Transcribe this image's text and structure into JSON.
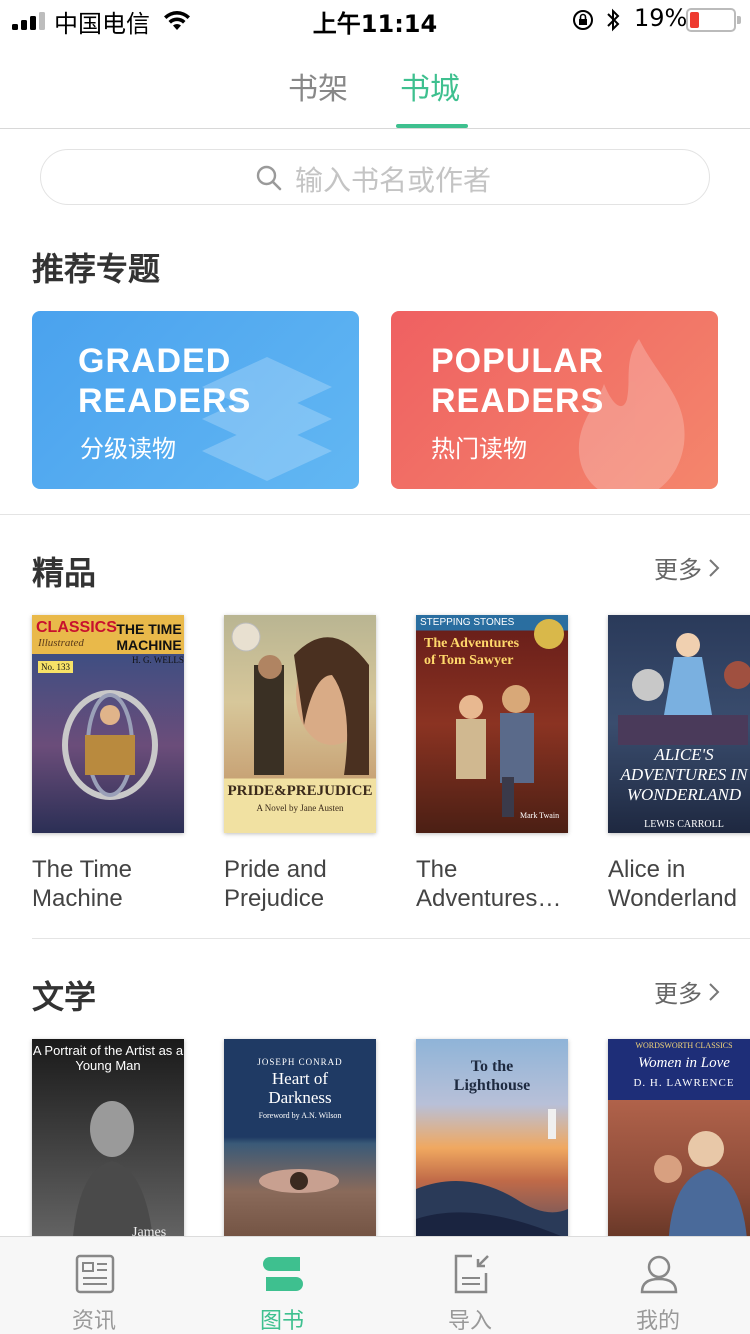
{
  "status_bar": {
    "carrier": "中国电信",
    "time": "上午11:14",
    "battery_percent": "19%",
    "battery_level": 0.19
  },
  "top_tabs": [
    {
      "label": "书架",
      "active": false
    },
    {
      "label": "书城",
      "active": true
    }
  ],
  "search": {
    "placeholder": "输入书名或作者"
  },
  "recommended": {
    "title": "推荐专题",
    "banners": [
      {
        "title_en_line1": "GRADED",
        "title_en_line2": "READERS",
        "title_cn": "分级读物",
        "color": "#4aa2ee"
      },
      {
        "title_en_line1": "POPULAR",
        "title_en_line2": "READERS",
        "title_cn": "热门读物",
        "color": "#ef6061"
      }
    ]
  },
  "featured": {
    "title": "精品",
    "more": "更多",
    "books": [
      {
        "title": "The Time Machine",
        "cover_top": "CLASSICS",
        "cover_sub": "Illustrated",
        "cover_title": "THE TIME MACHINE",
        "cover_author": "H. G. WELLS",
        "cover_no": "No. 133"
      },
      {
        "title": "Pride and Prejudice",
        "cover_title": "PRIDE&PREJUDICE",
        "cover_sub": "A Novel by Jane Austen"
      },
      {
        "title": "The Adventures…",
        "cover_top": "STEPPING STONES",
        "cover_title": "The Adventures of Tom Sawyer",
        "cover_author": "Mark Twain"
      },
      {
        "title": "Alice in Wonderland",
        "cover_title": "ALICE'S ADVENTURES IN WONDERLAND",
        "cover_author": "LEWIS CARROLL"
      }
    ]
  },
  "literature": {
    "title": "文学",
    "more": "更多",
    "books": [
      {
        "cover_title": "A Portrait of the Artist as a Young Man",
        "cover_author": "James"
      },
      {
        "cover_top": "JOSEPH CONRAD",
        "cover_title": "Heart of Darkness",
        "cover_sub": "Foreword by A.N. Wilson"
      },
      {
        "cover_title": "To the Lighthouse"
      },
      {
        "cover_top": "WORDSWORTH CLASSICS",
        "cover_title": "Women in Love",
        "cover_author": "D. H. LAWRENCE"
      }
    ]
  },
  "bottom_nav": [
    {
      "label": "资讯",
      "icon": "news-icon",
      "active": false
    },
    {
      "label": "图书",
      "icon": "books-icon",
      "active": true
    },
    {
      "label": "导入",
      "icon": "import-icon",
      "active": false
    },
    {
      "label": "我的",
      "icon": "profile-icon",
      "active": false
    }
  ],
  "colors": {
    "accent": "#3ec08f",
    "graded_blue": "#4aa2ee",
    "popular_red": "#ef6061"
  }
}
